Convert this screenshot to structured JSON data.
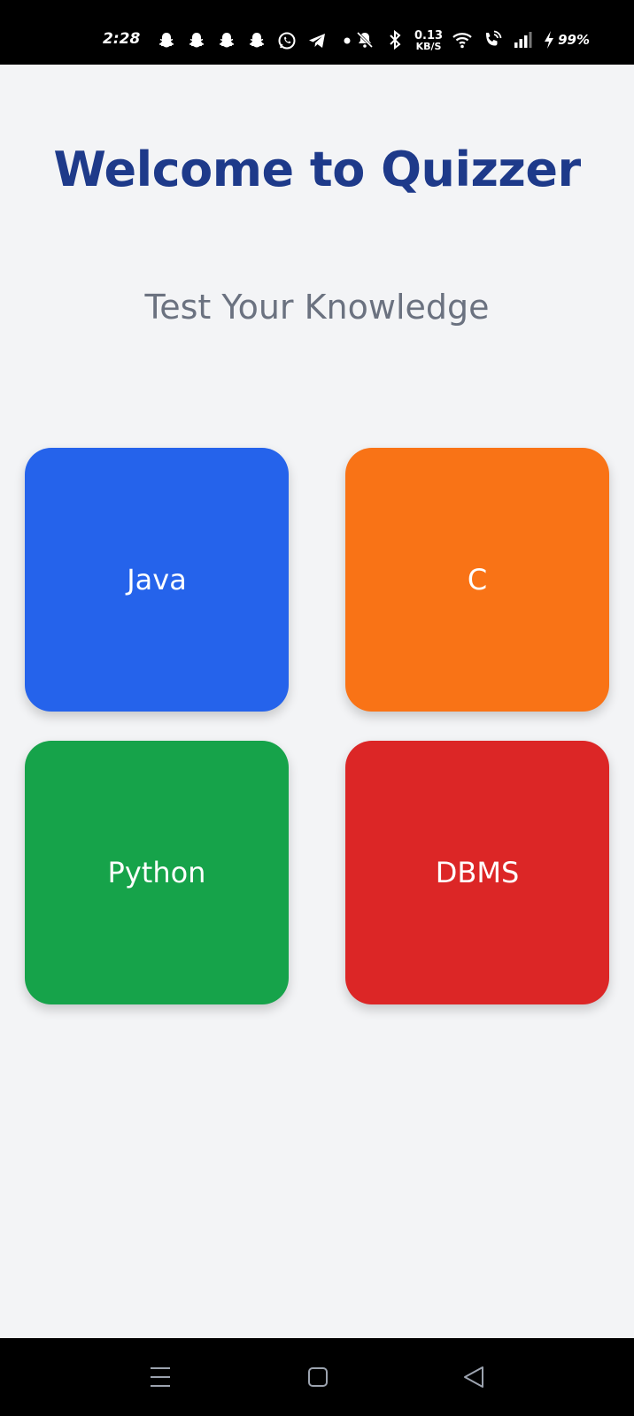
{
  "status_bar": {
    "time": "2:28",
    "net_speed_value": "0.13",
    "net_speed_unit": "KB/S",
    "battery": "99%",
    "icons_left": [
      "snapchat-icon",
      "snapchat-icon",
      "snapchat-icon",
      "snapchat-icon",
      "whatsapp-icon",
      "telegram-icon",
      "dot-icon"
    ],
    "icons_right": [
      "mute-icon",
      "bluetooth-icon",
      "wifi-icon",
      "wifi-call-icon",
      "signal-icon",
      "charging-icon"
    ]
  },
  "main": {
    "title": "Welcome to Quizzer",
    "subtitle": "Test Your Knowledge",
    "title_color": "#1e3a8a",
    "subtitle_color": "#6b7280",
    "background": "#f3f4f6",
    "cards": [
      {
        "label": "Java",
        "color": "#2563eb"
      },
      {
        "label": "C",
        "color": "#f97316"
      },
      {
        "label": "Python",
        "color": "#16a34a"
      },
      {
        "label": "DBMS",
        "color": "#dc2626"
      }
    ]
  },
  "nav_bar": {
    "icons": [
      "menu-icon",
      "home-icon",
      "back-icon"
    ]
  }
}
